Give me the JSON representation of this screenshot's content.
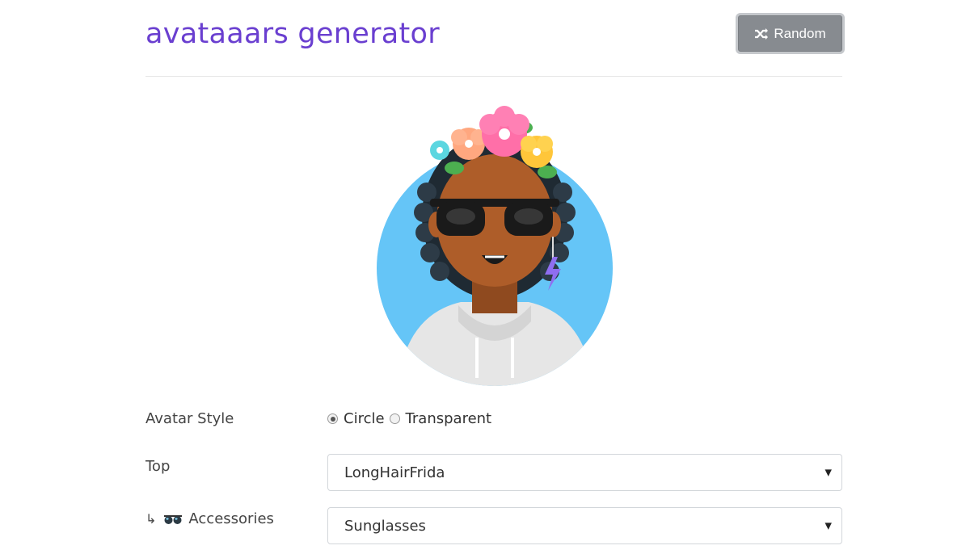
{
  "header": {
    "title": "avataaars generator",
    "random_label": "Random"
  },
  "avatar": {
    "style": "Circle",
    "background_color": "#65c5f7",
    "skin_color": "#ae5d29",
    "hair_color": "#2c1b18",
    "clothes_color": "#e6e6e6",
    "flower_colors": [
      "#ff6fa8",
      "#ffc63a",
      "#ffa77f",
      "#5bd6e0"
    ]
  },
  "form": {
    "avatar_style": {
      "label": "Avatar Style",
      "options": [
        "Circle",
        "Transparent"
      ],
      "selected": "Circle"
    },
    "top": {
      "label": "Top",
      "value": "LongHairFrida"
    },
    "accessories": {
      "prefix": "↳",
      "icon": "sunglasses-icon",
      "label": "Accessories",
      "value": "Sunglasses"
    }
  },
  "colors": {
    "title": "#6a3fd0",
    "button_bg": "#878b90"
  }
}
